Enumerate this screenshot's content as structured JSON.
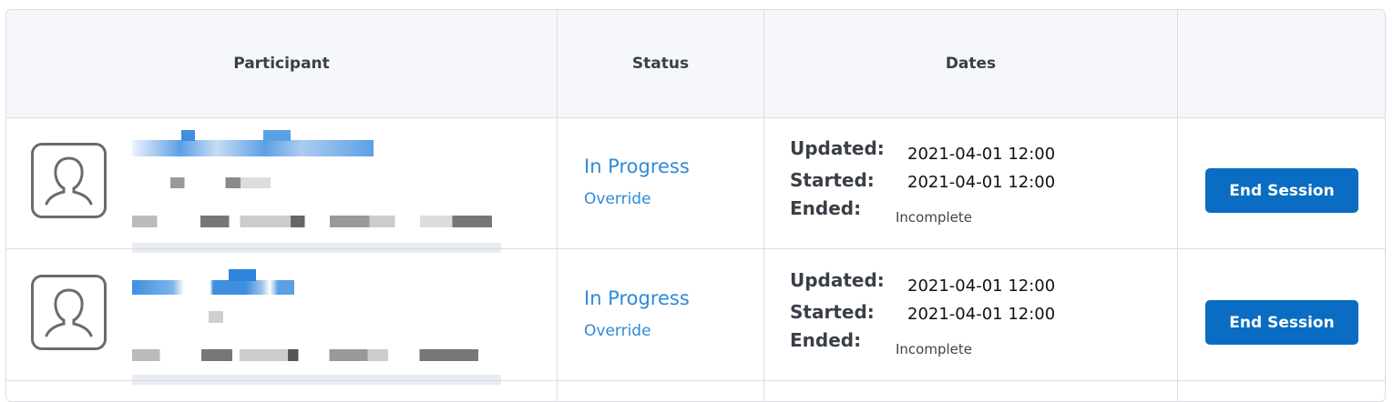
{
  "table": {
    "headers": {
      "participant": "Participant",
      "status": "Status",
      "dates": "Dates",
      "actions": ""
    },
    "rows": [
      {
        "participant_name": "",
        "status": "In Progress",
        "override_label": "Override",
        "updated_label": "Updated:",
        "updated_value": "2021-04-01 12:00",
        "started_label": "Started:",
        "started_value": "2021-04-01 12:00",
        "ended_label": "Ended:",
        "ended_value": "Incomplete",
        "action_label": "End Session"
      },
      {
        "participant_name": "",
        "status": "In Progress",
        "override_label": "Override",
        "updated_label": "Updated:",
        "updated_value": "2021-04-01 12:00",
        "started_label": "Started:",
        "started_value": "2021-04-01 12:00",
        "ended_label": "Ended:",
        "ended_value": "Incomplete",
        "action_label": "End Session"
      }
    ]
  },
  "icons": {
    "avatar": "user-avatar-icon"
  },
  "colors": {
    "link": "#2e8ad8",
    "button": "#0a6cc2",
    "header_bg": "#f5f7fb",
    "border": "#d9dde3"
  }
}
